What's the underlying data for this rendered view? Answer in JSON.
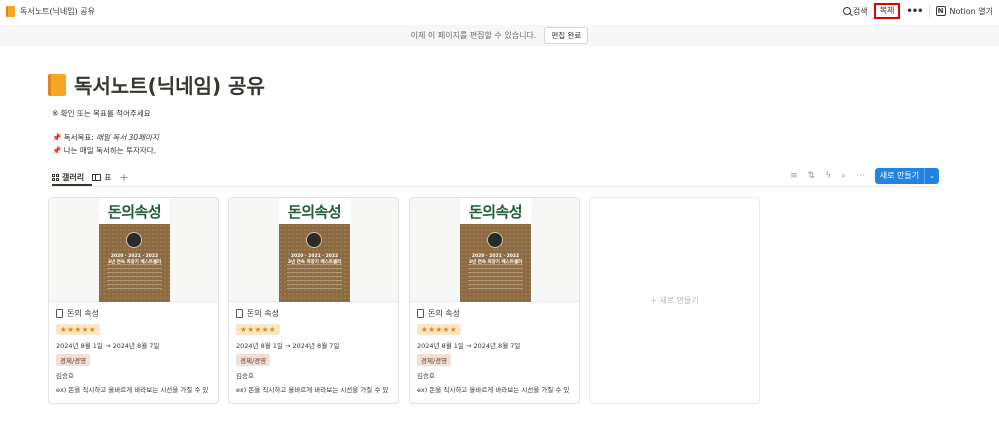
{
  "topbar": {
    "breadcrumb": "독서노트(닉네임) 공유",
    "search_label": "검색",
    "duplicate_label": "복제",
    "more_label": "•••",
    "notion_open_label": "Notion 열기",
    "notion_logo": "N"
  },
  "banner": {
    "message": "이제 이 페이지를 편집할 수 있습니다.",
    "done_label": "편집 완료"
  },
  "page": {
    "title": "독서노트(닉네임) 공유",
    "instruction": "※ 확인 또는 목표를 적어주세요",
    "goal_prefix": "📌 독서목표: ",
    "goal_value": "매일 독서 30페이지",
    "motto": "📌 나는 매일 독서하는 투자자다."
  },
  "views": {
    "tabs": [
      {
        "label": "갤러리"
      },
      {
        "label": "표"
      }
    ],
    "add": "+"
  },
  "toolbar": {
    "filter": "≡",
    "sort": "⇅",
    "automation": "ϟ",
    "search": "⌕",
    "more": "···",
    "new_label": "새로 만들기",
    "new_chevron": "⌄"
  },
  "cards": [
    {
      "cover_title": "돈의속성",
      "cover_years": "2020 · 2021 · 2022",
      "cover_sub": "3년 연속 최장기 베스트셀러",
      "name": "돈의 속성",
      "rating": "★★★★★",
      "dates": "2024년 8월 1일 → 2024년 8월 7일",
      "tag": "경제/경영",
      "author": "김승호",
      "memo": "ex) 돈을 직시하고 올바르게 바라보는 시선을 가질 수 있"
    },
    {
      "cover_title": "돈의속성",
      "cover_years": "2020 · 2021 · 2022",
      "cover_sub": "3년 연속 최장기 베스트셀러",
      "name": "돈의 속성",
      "rating": "★★★★★",
      "dates": "2024년 8월 1일 → 2024년 8월 7일",
      "tag": "경제/경영",
      "author": "김승호",
      "memo": "ex) 돈을 직시하고 올바르게 바라보는 시선을 가질 수 있"
    },
    {
      "cover_title": "돈의속성",
      "cover_years": "2020 · 2021 · 2022",
      "cover_sub": "3년 연속 최장기 베스트셀러",
      "name": "돈의 속성",
      "rating": "★★★★★",
      "dates": "2024년 8월 1일 → 2024년 8월 7일",
      "tag": "경제/경영",
      "author": "김승호",
      "memo": "ex) 돈을 직시하고 올바르게 바라보는 시선을 가질 수 있"
    }
  ],
  "new_card_label": "+ 새로 만들기",
  "colors": {
    "accent": "#2383e2",
    "highlight": "#e00000",
    "star": "#e58a00",
    "book_green": "#1f5c3a"
  }
}
